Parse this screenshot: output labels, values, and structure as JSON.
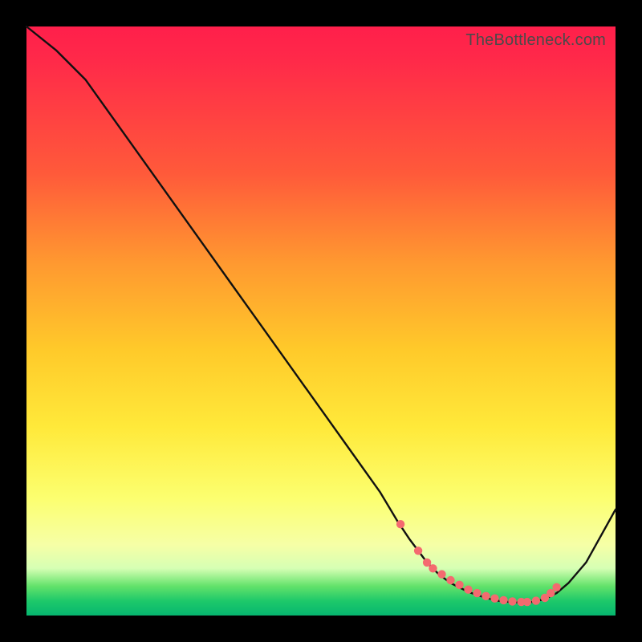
{
  "watermark": "TheBottleneck.com",
  "accent_colors": {
    "dot_fill": "#f46a6f",
    "curve_stroke": "#111111"
  },
  "chart_data": {
    "type": "line",
    "title": "",
    "xlabel": "",
    "ylabel": "",
    "xlim": [
      0,
      100
    ],
    "ylim": [
      0,
      100
    ],
    "series": [
      {
        "name": "bottleneck-curve",
        "x": [
          0,
          5,
          10,
          15,
          20,
          25,
          30,
          35,
          40,
          45,
          50,
          55,
          60,
          63,
          65,
          68,
          70,
          72,
          75,
          78,
          80,
          82,
          84,
          86,
          88,
          90,
          92,
          95,
          100
        ],
        "y": [
          100,
          96,
          91,
          84,
          77,
          70,
          63,
          56,
          49,
          42,
          35,
          28,
          21,
          16,
          13,
          9,
          7,
          5.5,
          4,
          3,
          2.5,
          2.3,
          2.2,
          2.3,
          2.8,
          3.8,
          5.5,
          9,
          18
        ]
      }
    ],
    "markers": {
      "name": "highlight-dots",
      "x": [
        63.5,
        66.5,
        68,
        69,
        70.5,
        72,
        73.5,
        75,
        76.5,
        78,
        79.5,
        81,
        82.5,
        84,
        85,
        86.5,
        88,
        89,
        90
      ],
      "y": [
        15.5,
        11,
        9,
        8,
        7,
        6,
        5.2,
        4.4,
        3.8,
        3.3,
        2.9,
        2.6,
        2.4,
        2.3,
        2.3,
        2.5,
        3.0,
        3.8,
        4.8
      ]
    }
  }
}
